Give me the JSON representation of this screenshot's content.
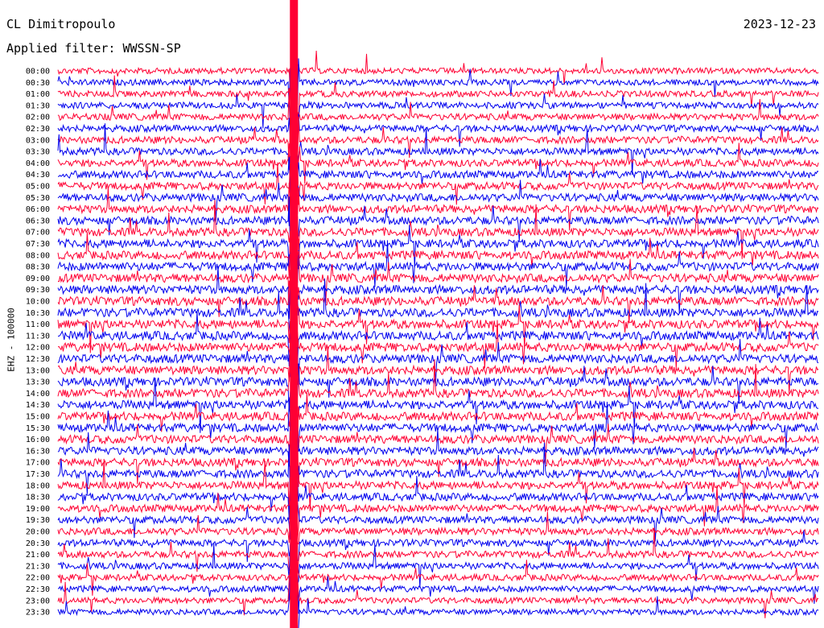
{
  "header": {
    "station": "CL Dimitropoulo",
    "filter": "Applied filter: WWSSN-SP",
    "date": "2023-12-23"
  },
  "colors": {
    "even_rows": "#ff0033",
    "odd_rows": "#0000ee",
    "background": "#ffffff"
  },
  "chart_data": {
    "type": "line",
    "title": "",
    "xlabel": "",
    "ylabel": "EHZ - 100000",
    "row_labels": [
      "00:00",
      "00:30",
      "01:00",
      "01:30",
      "02:00",
      "02:30",
      "03:00",
      "03:30",
      "04:00",
      "04:30",
      "05:00",
      "05:30",
      "06:00",
      "06:30",
      "07:00",
      "07:30",
      "08:00",
      "08:30",
      "09:00",
      "09:30",
      "10:00",
      "10:30",
      "11:00",
      "11:30",
      "12:00",
      "12:30",
      "13:00",
      "13:30",
      "14:00",
      "14:30",
      "15:00",
      "15:30",
      "16:00",
      "16:30",
      "17:00",
      "17:30",
      "18:00",
      "18:30",
      "19:00",
      "19:30",
      "20:00",
      "20:30",
      "21:00",
      "21:30",
      "22:00",
      "22:30",
      "23:00",
      "23:30"
    ],
    "row_minutes": 30,
    "grid": false,
    "events": [
      {
        "rows": [
          0,
          47
        ],
        "minute": 9.3,
        "note": "major event saturating all traces"
      }
    ]
  }
}
